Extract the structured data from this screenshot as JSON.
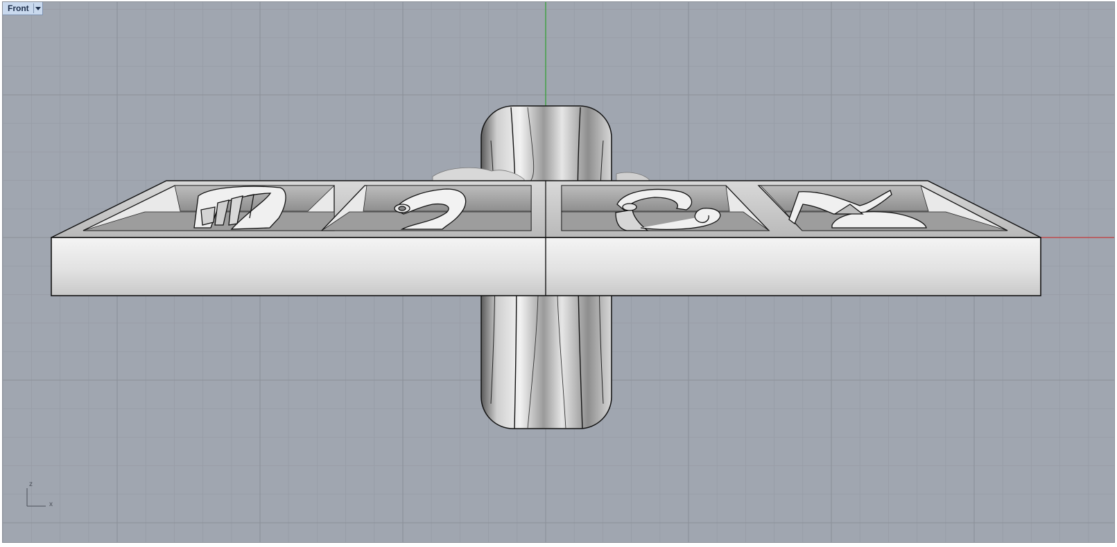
{
  "viewport": {
    "title": "Front",
    "menu_icon": "chevron-down-icon",
    "background_color": "#a0a6b0",
    "grid_minor_color": "#979ca6",
    "grid_major_color": "#8b9099",
    "x_axis_color": "#c23b3b",
    "z_axis_color": "#2ea02e",
    "model_light_color": "#ececec",
    "model_dark_color": "#6a6a6a",
    "outline_color": "#111111"
  },
  "axis_widget": {
    "vertical_label": "z",
    "horizontal_label": "x"
  },
  "model": {
    "name": "ring-with-four-zodiac-symbols",
    "symbols": [
      "virgo",
      "leo",
      "cancer",
      "taurus"
    ]
  }
}
